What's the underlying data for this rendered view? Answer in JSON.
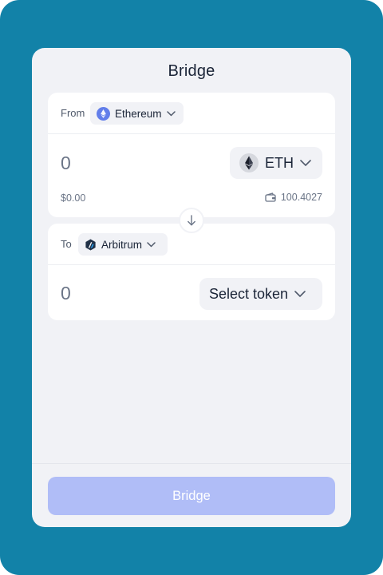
{
  "header": {
    "title": "Bridge"
  },
  "from": {
    "label": "From",
    "chain": "Ethereum",
    "amount": "0",
    "token": "ETH",
    "usd_value": "$0.00",
    "balance": "100.4027"
  },
  "to": {
    "label": "To",
    "chain": "Arbitrum",
    "amount": "0",
    "token_placeholder": "Select token"
  },
  "actions": {
    "bridge_label": "Bridge"
  },
  "icons": {
    "ethereum_chain": "ethereum-logo-icon",
    "arbitrum_chain": "arbitrum-logo-icon",
    "eth_token": "eth-diamond-icon",
    "chevron": "chevron-down-icon",
    "wallet": "wallet-icon",
    "swap": "arrow-down-icon"
  },
  "colors": {
    "background": "#1282a8",
    "card": "#f1f2f6",
    "panel": "#ffffff",
    "accent_disabled": "#b0bdf7",
    "ethereum": "#627eea",
    "arbitrum": "#213147"
  }
}
